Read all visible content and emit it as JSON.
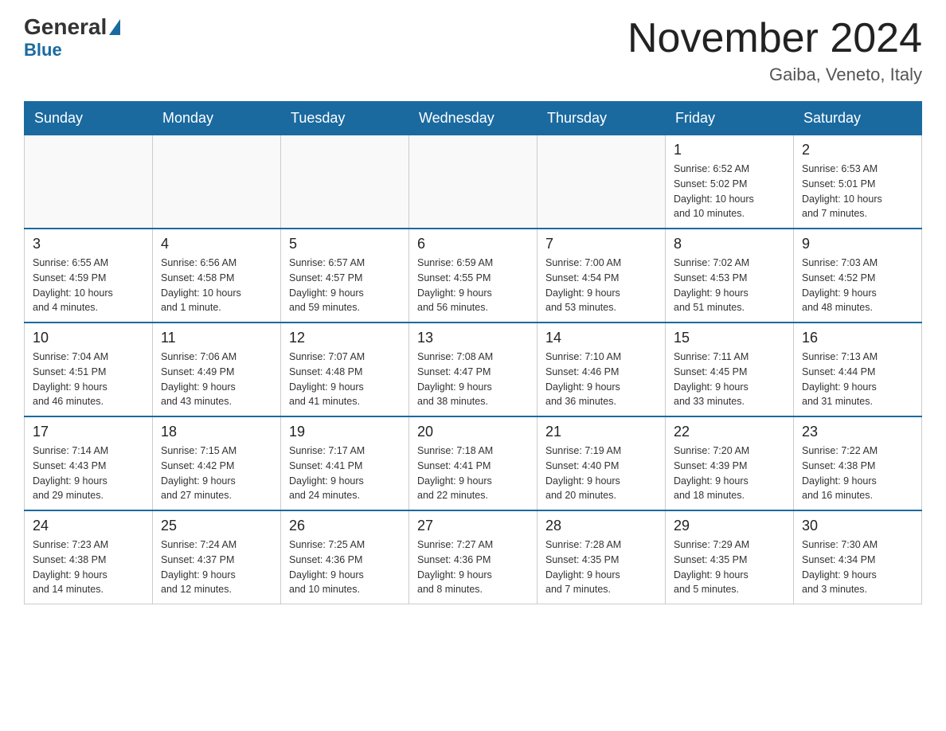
{
  "header": {
    "logo_general": "General",
    "logo_blue": "Blue",
    "month_title": "November 2024",
    "location": "Gaiba, Veneto, Italy"
  },
  "days_of_week": [
    "Sunday",
    "Monday",
    "Tuesday",
    "Wednesday",
    "Thursday",
    "Friday",
    "Saturday"
  ],
  "weeks": [
    [
      {
        "day": "",
        "info": ""
      },
      {
        "day": "",
        "info": ""
      },
      {
        "day": "",
        "info": ""
      },
      {
        "day": "",
        "info": ""
      },
      {
        "day": "",
        "info": ""
      },
      {
        "day": "1",
        "info": "Sunrise: 6:52 AM\nSunset: 5:02 PM\nDaylight: 10 hours\nand 10 minutes."
      },
      {
        "day": "2",
        "info": "Sunrise: 6:53 AM\nSunset: 5:01 PM\nDaylight: 10 hours\nand 7 minutes."
      }
    ],
    [
      {
        "day": "3",
        "info": "Sunrise: 6:55 AM\nSunset: 4:59 PM\nDaylight: 10 hours\nand 4 minutes."
      },
      {
        "day": "4",
        "info": "Sunrise: 6:56 AM\nSunset: 4:58 PM\nDaylight: 10 hours\nand 1 minute."
      },
      {
        "day": "5",
        "info": "Sunrise: 6:57 AM\nSunset: 4:57 PM\nDaylight: 9 hours\nand 59 minutes."
      },
      {
        "day": "6",
        "info": "Sunrise: 6:59 AM\nSunset: 4:55 PM\nDaylight: 9 hours\nand 56 minutes."
      },
      {
        "day": "7",
        "info": "Sunrise: 7:00 AM\nSunset: 4:54 PM\nDaylight: 9 hours\nand 53 minutes."
      },
      {
        "day": "8",
        "info": "Sunrise: 7:02 AM\nSunset: 4:53 PM\nDaylight: 9 hours\nand 51 minutes."
      },
      {
        "day": "9",
        "info": "Sunrise: 7:03 AM\nSunset: 4:52 PM\nDaylight: 9 hours\nand 48 minutes."
      }
    ],
    [
      {
        "day": "10",
        "info": "Sunrise: 7:04 AM\nSunset: 4:51 PM\nDaylight: 9 hours\nand 46 minutes."
      },
      {
        "day": "11",
        "info": "Sunrise: 7:06 AM\nSunset: 4:49 PM\nDaylight: 9 hours\nand 43 minutes."
      },
      {
        "day": "12",
        "info": "Sunrise: 7:07 AM\nSunset: 4:48 PM\nDaylight: 9 hours\nand 41 minutes."
      },
      {
        "day": "13",
        "info": "Sunrise: 7:08 AM\nSunset: 4:47 PM\nDaylight: 9 hours\nand 38 minutes."
      },
      {
        "day": "14",
        "info": "Sunrise: 7:10 AM\nSunset: 4:46 PM\nDaylight: 9 hours\nand 36 minutes."
      },
      {
        "day": "15",
        "info": "Sunrise: 7:11 AM\nSunset: 4:45 PM\nDaylight: 9 hours\nand 33 minutes."
      },
      {
        "day": "16",
        "info": "Sunrise: 7:13 AM\nSunset: 4:44 PM\nDaylight: 9 hours\nand 31 minutes."
      }
    ],
    [
      {
        "day": "17",
        "info": "Sunrise: 7:14 AM\nSunset: 4:43 PM\nDaylight: 9 hours\nand 29 minutes."
      },
      {
        "day": "18",
        "info": "Sunrise: 7:15 AM\nSunset: 4:42 PM\nDaylight: 9 hours\nand 27 minutes."
      },
      {
        "day": "19",
        "info": "Sunrise: 7:17 AM\nSunset: 4:41 PM\nDaylight: 9 hours\nand 24 minutes."
      },
      {
        "day": "20",
        "info": "Sunrise: 7:18 AM\nSunset: 4:41 PM\nDaylight: 9 hours\nand 22 minutes."
      },
      {
        "day": "21",
        "info": "Sunrise: 7:19 AM\nSunset: 4:40 PM\nDaylight: 9 hours\nand 20 minutes."
      },
      {
        "day": "22",
        "info": "Sunrise: 7:20 AM\nSunset: 4:39 PM\nDaylight: 9 hours\nand 18 minutes."
      },
      {
        "day": "23",
        "info": "Sunrise: 7:22 AM\nSunset: 4:38 PM\nDaylight: 9 hours\nand 16 minutes."
      }
    ],
    [
      {
        "day": "24",
        "info": "Sunrise: 7:23 AM\nSunset: 4:38 PM\nDaylight: 9 hours\nand 14 minutes."
      },
      {
        "day": "25",
        "info": "Sunrise: 7:24 AM\nSunset: 4:37 PM\nDaylight: 9 hours\nand 12 minutes."
      },
      {
        "day": "26",
        "info": "Sunrise: 7:25 AM\nSunset: 4:36 PM\nDaylight: 9 hours\nand 10 minutes."
      },
      {
        "day": "27",
        "info": "Sunrise: 7:27 AM\nSunset: 4:36 PM\nDaylight: 9 hours\nand 8 minutes."
      },
      {
        "day": "28",
        "info": "Sunrise: 7:28 AM\nSunset: 4:35 PM\nDaylight: 9 hours\nand 7 minutes."
      },
      {
        "day": "29",
        "info": "Sunrise: 7:29 AM\nSunset: 4:35 PM\nDaylight: 9 hours\nand 5 minutes."
      },
      {
        "day": "30",
        "info": "Sunrise: 7:30 AM\nSunset: 4:34 PM\nDaylight: 9 hours\nand 3 minutes."
      }
    ]
  ]
}
